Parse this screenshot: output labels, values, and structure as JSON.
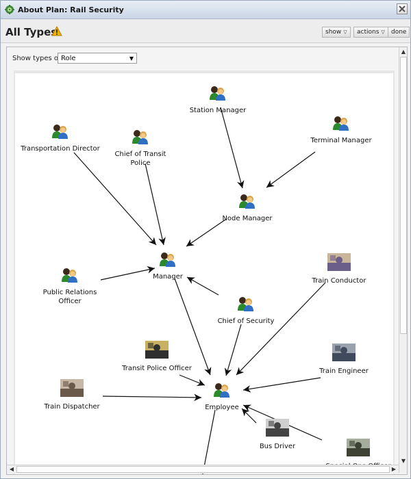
{
  "window": {
    "title": "About Plan: Rail Security",
    "close_icon": "close-icon",
    "app_icon": "gear-icon"
  },
  "header": {
    "title": "All Types",
    "warning_icon": "warning-icon",
    "show_label": "show",
    "actions_label": "actions",
    "done_label": "done"
  },
  "filter": {
    "label": "Show types of",
    "selected": "Role"
  },
  "graph": {
    "nodes": [
      {
        "id": "station_manager",
        "label": "Station Manager"
      },
      {
        "id": "terminal_manager",
        "label": "Terminal Manager"
      },
      {
        "id": "transportation_director",
        "label": "Transportation Director"
      },
      {
        "id": "chief_transit_police",
        "label": "Chief of Transit Police"
      },
      {
        "id": "node_manager",
        "label": "Node Manager"
      },
      {
        "id": "manager",
        "label": "Manager"
      },
      {
        "id": "public_relations",
        "label": "Public Relations Officer"
      },
      {
        "id": "chief_security",
        "label": "Chief of Security"
      },
      {
        "id": "train_conductor",
        "label": "Train Conductor"
      },
      {
        "id": "transit_police_officer",
        "label": "Transit Police Officer"
      },
      {
        "id": "train_engineer",
        "label": "Train Engineer"
      },
      {
        "id": "train_dispatcher",
        "label": "Train Dispatcher"
      },
      {
        "id": "employee",
        "label": "Employee"
      },
      {
        "id": "bus_driver",
        "label": "Bus Driver"
      },
      {
        "id": "special_ops_officer",
        "label": "Special Ops Officer"
      }
    ],
    "edges": [
      [
        "station_manager",
        "node_manager"
      ],
      [
        "terminal_manager",
        "node_manager"
      ],
      [
        "node_manager",
        "manager"
      ],
      [
        "transportation_director",
        "manager"
      ],
      [
        "chief_transit_police",
        "manager"
      ],
      [
        "public_relations",
        "manager"
      ],
      [
        "chief_security",
        "manager"
      ],
      [
        "manager",
        "employee"
      ],
      [
        "chief_security",
        "employee"
      ],
      [
        "train_conductor",
        "employee"
      ],
      [
        "transit_police_officer",
        "employee"
      ],
      [
        "train_engineer",
        "employee"
      ],
      [
        "train_dispatcher",
        "employee"
      ],
      [
        "bus_driver",
        "employee"
      ],
      [
        "special_ops_officer",
        "employee"
      ]
    ]
  },
  "colors": {
    "titlebar_top": "#e9eef6",
    "titlebar_bottom": "#c9d5e6",
    "warning": "#f2b200"
  }
}
